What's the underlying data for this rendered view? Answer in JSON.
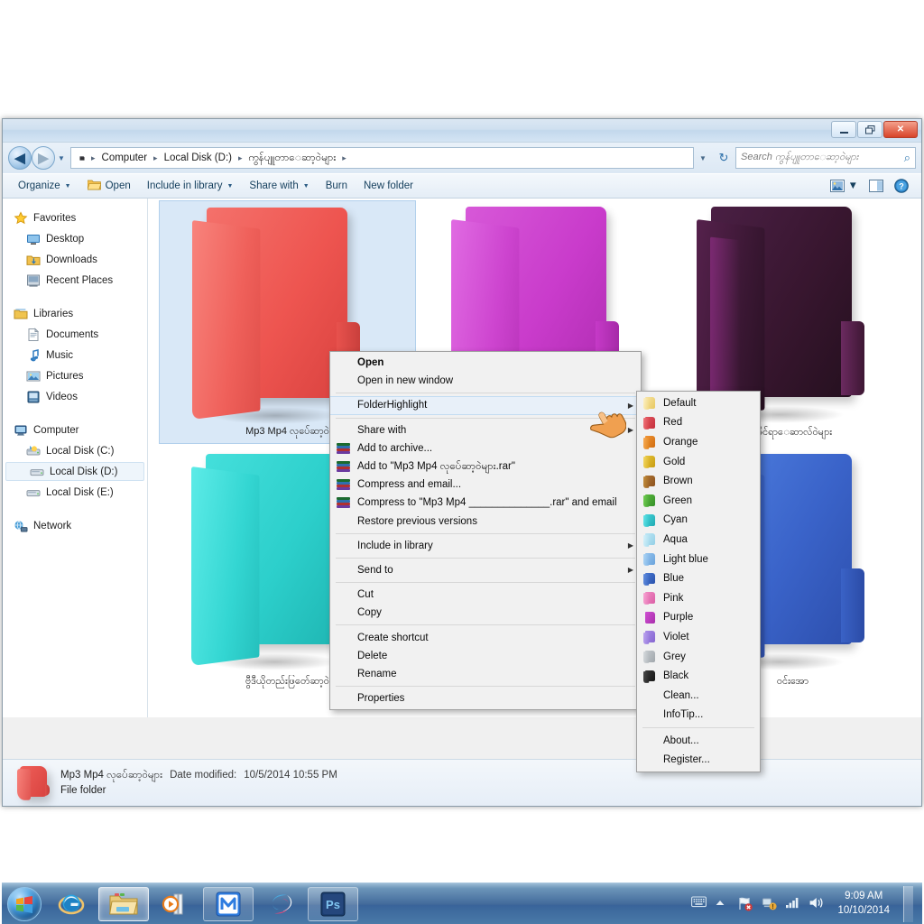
{
  "window": {
    "title": "",
    "controls": {
      "minimize": "—",
      "maximize": "❐",
      "close": "✕"
    }
  },
  "address": {
    "crumbs": [
      "Computer",
      "Local Disk (D:)",
      "ကွန်ပျူတာေဆာ့ဝဲများ"
    ],
    "separator": "▸"
  },
  "search": {
    "placeholder": "Search ကွန်ပျူတာေဆာ့ဝဲများ"
  },
  "toolbar": {
    "organize": "Organize",
    "open": "Open",
    "include_in_library": "Include in library",
    "share_with": "Share with",
    "burn": "Burn",
    "new_folder": "New folder"
  },
  "sidebar": {
    "groups": [
      {
        "header": "Favorites",
        "icon": "star-icon",
        "items": [
          {
            "label": "Desktop",
            "icon": "desktop-icon"
          },
          {
            "label": "Downloads",
            "icon": "downloads-icon"
          },
          {
            "label": "Recent Places",
            "icon": "recent-places-icon"
          }
        ]
      },
      {
        "header": "Libraries",
        "icon": "libraries-icon",
        "items": [
          {
            "label": "Documents",
            "icon": "document-icon"
          },
          {
            "label": "Music",
            "icon": "music-note-icon"
          },
          {
            "label": "Pictures",
            "icon": "picture-icon"
          },
          {
            "label": "Videos",
            "icon": "video-icon"
          }
        ]
      },
      {
        "header": "Computer",
        "icon": "computer-icon",
        "items": [
          {
            "label": "Local Disk (C:)",
            "icon": "system-drive-icon",
            "selected": false
          },
          {
            "label": "Local Disk (D:)",
            "icon": "drive-icon",
            "selected": true
          },
          {
            "label": "Local Disk (E:)",
            "icon": "drive-icon",
            "selected": false
          }
        ]
      },
      {
        "header": "Network",
        "icon": "network-icon",
        "items": []
      }
    ]
  },
  "folders": [
    {
      "name": "Mp3 Mp4 လုပ်ေဆာ့ဝဲ",
      "color": "#ef5a55",
      "selected": true
    },
    {
      "name": "",
      "color": "#cd3fd0",
      "selected": false
    },
    {
      "name": "အိုင်ရာေဆာလ်ဝဲများ",
      "color": "#35122f",
      "selected": false
    },
    {
      "name": "ဗွီဒီယိုတည်းဖြတ်ေဆာ့ဝဲ",
      "color": "#28d2cf",
      "selected": false
    },
    {
      "name": "ဝင်းအော",
      "color": "#3c63c8",
      "selected": false
    }
  ],
  "details": {
    "name": "Mp3 Mp4 လုပ်ေဆာ့ဝဲများ",
    "date_label": "Date modified:",
    "date_value": "10/5/2014 10:55 PM",
    "type": "File folder"
  },
  "context_menu": {
    "items": [
      {
        "label": "Open",
        "bold": true,
        "icon": "",
        "arrow": false
      },
      {
        "label": "Open in new window",
        "bold": false,
        "icon": "",
        "arrow": false
      },
      {
        "separator": true
      },
      {
        "label": "FolderHighlight",
        "bold": false,
        "icon": "",
        "arrow": true,
        "highlighted": true
      },
      {
        "separator": true
      },
      {
        "label": "Share with",
        "bold": false,
        "icon": "",
        "arrow": true
      },
      {
        "label": "Add to archive...",
        "bold": false,
        "icon": "winrar-icon",
        "arrow": false
      },
      {
        "label": "Add to \"Mp3 Mp4 လုပ်ေဆာ့ဝဲများ.rar\"",
        "bold": false,
        "icon": "winrar-icon",
        "arrow": false
      },
      {
        "label": "Compress and email...",
        "bold": false,
        "icon": "winrar-icon",
        "arrow": false
      },
      {
        "label": "Compress to \"Mp3 Mp4 ______________.rar\" and email",
        "bold": false,
        "icon": "winrar-icon",
        "arrow": false
      },
      {
        "label": "Restore previous versions",
        "bold": false,
        "icon": "",
        "arrow": false
      },
      {
        "separator": true
      },
      {
        "label": "Include in library",
        "bold": false,
        "icon": "",
        "arrow": true
      },
      {
        "separator": true
      },
      {
        "label": "Send to",
        "bold": false,
        "icon": "",
        "arrow": true
      },
      {
        "separator": true
      },
      {
        "label": "Cut",
        "bold": false,
        "icon": "",
        "arrow": false
      },
      {
        "label": "Copy",
        "bold": false,
        "icon": "",
        "arrow": false
      },
      {
        "separator": true
      },
      {
        "label": "Create shortcut",
        "bold": false,
        "icon": "",
        "arrow": false
      },
      {
        "label": "Delete",
        "bold": false,
        "icon": "",
        "arrow": false
      },
      {
        "label": "Rename",
        "bold": false,
        "icon": "",
        "arrow": false
      },
      {
        "separator": true
      },
      {
        "label": "Properties",
        "bold": false,
        "icon": "",
        "arrow": false
      }
    ]
  },
  "submenu": {
    "items": [
      {
        "label": "Default",
        "color": "#f3d98a",
        "icon": "folder-icon"
      },
      {
        "label": "Red",
        "color": "#d9404a",
        "icon": "folder-icon"
      },
      {
        "label": "Orange",
        "color": "#e8801f",
        "icon": "folder-icon"
      },
      {
        "label": "Gold",
        "color": "#dcb423",
        "icon": "folder-icon"
      },
      {
        "label": "Brown",
        "color": "#a4692a",
        "icon": "folder-icon"
      },
      {
        "label": "Green",
        "color": "#4aa832",
        "icon": "folder-icon"
      },
      {
        "label": "Cyan",
        "color": "#2fc4cc",
        "icon": "folder-icon"
      },
      {
        "label": "Aqua",
        "color": "#a7dced",
        "icon": "folder-icon"
      },
      {
        "label": "Light blue",
        "color": "#7fb6e8",
        "icon": "folder-icon"
      },
      {
        "label": "Blue",
        "color": "#3768c4",
        "icon": "folder-icon"
      },
      {
        "label": "Pink",
        "color": "#e87bb8",
        "icon": "folder-icon"
      },
      {
        "label": "Purple",
        "color": "#c33fc6",
        "icon": "folder-icon"
      },
      {
        "label": "Violet",
        "color": "#9b7fe0",
        "icon": "folder-icon"
      },
      {
        "label": "Grey",
        "color": "#b4b9bd",
        "icon": "folder-icon"
      },
      {
        "label": "Black",
        "color": "#2b2b2b",
        "icon": "folder-icon"
      },
      {
        "label": "Clean...",
        "color": "",
        "icon": ""
      },
      {
        "label": "InfoTip...",
        "color": "",
        "icon": ""
      },
      {
        "separator": true
      },
      {
        "label": "About...",
        "color": "",
        "icon": ""
      },
      {
        "label": "Register...",
        "color": "",
        "icon": ""
      }
    ]
  },
  "taskbar": {
    "start": "start-orb",
    "buttons": [
      {
        "name": "internet-explorer",
        "state": "normal"
      },
      {
        "name": "windows-explorer",
        "state": "active"
      },
      {
        "name": "media-player",
        "state": "normal"
      },
      {
        "name": "maxthon-browser",
        "state": "open"
      },
      {
        "name": "maxthon-cloud",
        "state": "normal"
      },
      {
        "name": "photoshop",
        "state": "open"
      }
    ],
    "tray": [
      "keyboard-icon",
      "show-hidden-icon",
      "action-center-icon",
      "network-icon",
      "signal-icon",
      "volume-icon"
    ],
    "clock": {
      "time": "9:09 AM",
      "date": "10/10/2014"
    }
  }
}
